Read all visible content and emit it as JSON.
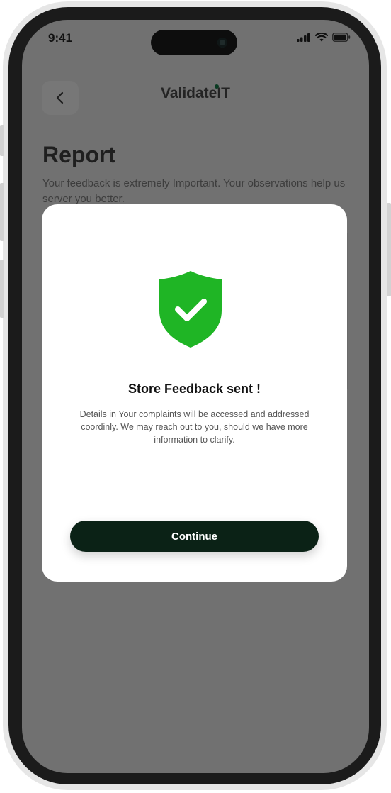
{
  "status_bar": {
    "time": "9:41",
    "icons": [
      "signal-icon",
      "wifi-icon",
      "battery-icon"
    ]
  },
  "header": {
    "back_icon": "chevron-left-icon",
    "logo": "ValidateIT"
  },
  "page": {
    "title": "Report",
    "description": "Your feedback is extremely Important. Your observations help us server you better."
  },
  "modal": {
    "icon": "shield-check-icon",
    "title": "Store Feedback sent !",
    "body": "Details in Your complaints will be accessed and addressed coordinly. We may reach out to you, should we have more information to clarify.",
    "continue_label": "Continue"
  },
  "colors": {
    "overlay": "#717171",
    "accent_green": "#1fb525",
    "button_dark": "#0b2216",
    "modal_bg": "#ffffff"
  }
}
